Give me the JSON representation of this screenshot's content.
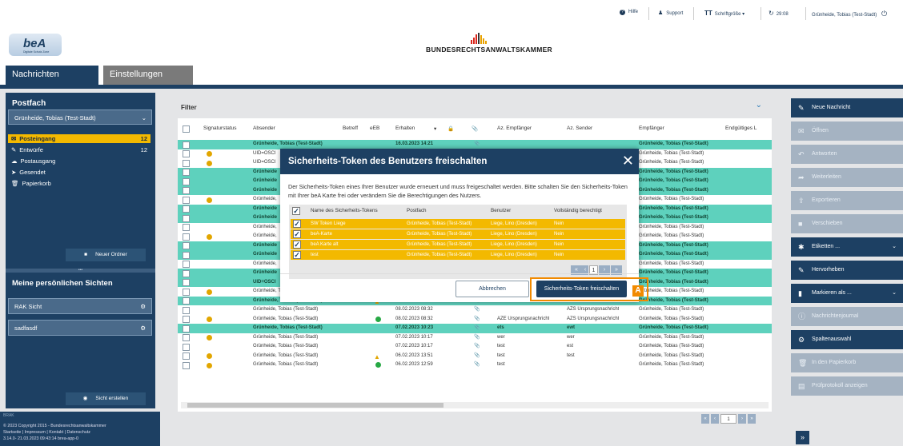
{
  "topbar": {
    "help": "Hilfe",
    "support": "Support",
    "fontsize": "Schriftgröße",
    "timer": "29:08",
    "user": "Grünheide, Tobias (Test-Stadt)"
  },
  "brand": {
    "logo_text": "beA",
    "logo_sub": "Digitale Schutz Zone",
    "org": "BUNDESRECHTSANWALTSKAMMER"
  },
  "nav": {
    "tabs": [
      "Nachrichten",
      "Einstellungen"
    ]
  },
  "sidebar": {
    "postfach_title": "Postfach",
    "postfach_select": "Grünheide, Tobias (Test-Stadt)",
    "folders": [
      {
        "label": "Posteingang",
        "count": "12",
        "icon": "inbox-icon"
      },
      {
        "label": "Entwürfe",
        "count": "12",
        "icon": "edit-icon"
      },
      {
        "label": "Postausgang",
        "count": "",
        "icon": "outbox-icon"
      },
      {
        "label": "Gesendet",
        "count": "",
        "icon": "send-icon"
      },
      {
        "label": "Papierkorb",
        "count": "",
        "icon": "trash-icon"
      }
    ],
    "new_folder": "Neuer Ordner",
    "views_title": "Meine persönlichen Sichten",
    "views": [
      "RAK Sicht",
      "sadfasdf"
    ],
    "create_view": "Sicht erstellen",
    "footer_copyright": "© 2023 Copyright 2015 - Bundesrechtsanwaltskammer",
    "footer_links": "Startseite | Impressum | Kontakt | Datenschutz",
    "footer_version": "3.14.0- 21.03.2023 09:43:14 brea-app-0",
    "footer_logo": "BRAK"
  },
  "filter": {
    "label": "Filter"
  },
  "table": {
    "headers": [
      "Signaturstatus",
      "Absender",
      "Betreff",
      "eEB",
      "Erhalten",
      "Az. Empfänger",
      "Az. Sender",
      "Empfänger",
      "Endgültiges L"
    ],
    "rows": [
      {
        "green": true,
        "dot": false,
        "mark": "",
        "absender": "Grünheide, Tobias (Test-Stadt)",
        "erhalten": "16.03.2023 14:21",
        "clip": true,
        "az_emp": "",
        "az_sen": "",
        "empf": "Grünheide, Tobias (Test-Stadt)"
      },
      {
        "green": false,
        "dot": true,
        "mark": "",
        "absender": "UID=OSCI",
        "erhalten": "",
        "clip": false,
        "az_emp": "",
        "az_sen": "",
        "empf": "Grünheide, Tobias (Test-Stadt)"
      },
      {
        "green": false,
        "dot": true,
        "mark": "",
        "absender": "UID=OSCI",
        "erhalten": "",
        "clip": false,
        "az_emp": "",
        "az_sen": "",
        "empf": "Grünheide, Tobias (Test-Stadt)"
      },
      {
        "green": true,
        "dot": false,
        "mark": "",
        "absender": "Grünheide",
        "erhalten": "",
        "clip": false,
        "az_emp": "",
        "az_sen": "",
        "empf": "Grünheide, Tobias (Test-Stadt)"
      },
      {
        "green": true,
        "dot": false,
        "mark": "",
        "absender": "Grünheide",
        "erhalten": "",
        "clip": false,
        "az_emp": "",
        "az_sen": "",
        "empf": "Grünheide, Tobias (Test-Stadt)"
      },
      {
        "green": true,
        "dot": false,
        "mark": "",
        "absender": "Grünheide",
        "erhalten": "",
        "clip": false,
        "az_emp": "",
        "az_sen": "",
        "empf": "Grünheide, Tobias (Test-Stadt)"
      },
      {
        "green": false,
        "dot": true,
        "mark": "",
        "absender": "Grünheide,",
        "erhalten": "",
        "clip": false,
        "az_emp": "",
        "az_sen": "",
        "empf": "Grünheide, Tobias (Test-Stadt)"
      },
      {
        "green": true,
        "dot": false,
        "mark": "",
        "absender": "Grünheide",
        "erhalten": "",
        "clip": false,
        "az_emp": "",
        "az_sen": "",
        "empf": "Grünheide, Tobias (Test-Stadt)"
      },
      {
        "green": true,
        "dot": false,
        "mark": "",
        "absender": "Grünheide",
        "erhalten": "",
        "clip": false,
        "az_emp": "",
        "az_sen": "",
        "empf": "Grünheide, Tobias (Test-Stadt)"
      },
      {
        "green": false,
        "dot": false,
        "mark": "",
        "absender": "Grünheide,",
        "erhalten": "",
        "clip": false,
        "az_emp": "",
        "az_sen": "",
        "empf": "Grünheide, Tobias (Test-Stadt)"
      },
      {
        "green": false,
        "dot": true,
        "mark": "",
        "absender": "Grünheide,",
        "erhalten": "",
        "clip": false,
        "az_emp": "",
        "az_sen": "",
        "empf": "Grünheide, Tobias (Test-Stadt)"
      },
      {
        "green": true,
        "dot": false,
        "mark": "",
        "absender": "Grünheide",
        "erhalten": "",
        "clip": false,
        "az_emp": "",
        "az_sen": "",
        "empf": "Grünheide, Tobias (Test-Stadt)"
      },
      {
        "green": true,
        "dot": false,
        "mark": "",
        "absender": "Grünheide",
        "erhalten": "",
        "clip": false,
        "az_emp": "",
        "az_sen": "",
        "empf": "Grünheide, Tobias (Test-Stadt)"
      },
      {
        "green": false,
        "dot": false,
        "mark": "",
        "absender": "Grünheide,",
        "erhalten": "",
        "clip": false,
        "az_emp": "",
        "az_sen": "",
        "empf": "Grünheide, Tobias (Test-Stadt)"
      },
      {
        "green": true,
        "dot": false,
        "mark": "",
        "absender": "Grünheide",
        "erhalten": "",
        "clip": false,
        "az_emp": "",
        "az_sen": "",
        "empf": "Grünheide, Tobias (Test-Stadt)"
      },
      {
        "green": true,
        "dot": false,
        "mark": "",
        "absender": "UID=OSCI",
        "erhalten": "",
        "clip": false,
        "az_emp": "",
        "az_sen": "",
        "empf": "Grünheide, Tobias (Test-Stadt)"
      },
      {
        "green": false,
        "dot": true,
        "mark": "warn",
        "absender": "Grünheide, Tobias (Test-Stadt)",
        "erhalten": "14.02.2023 09:21",
        "clip": true,
        "az_emp": "test",
        "az_sen": "test",
        "empf": "Grünheide, Tobias (Test-Stadt)"
      },
      {
        "green": true,
        "dot": false,
        "mark": "warn",
        "absender": "Grünheide, Tobias (Test-Stadt)",
        "erhalten": "14.02.2023 09:19",
        "clip": true,
        "az_emp": "test",
        "az_sen": "test",
        "empf": "Grünheide, Tobias (Test-Stadt)"
      },
      {
        "green": false,
        "dot": false,
        "mark": "",
        "absender": "Grünheide, Tobias (Test-Stadt)",
        "erhalten": "08.02.2023 08:32",
        "clip": true,
        "az_emp": "",
        "az_sen": "AZS Ursprungsnachricht",
        "empf": "Grünheide, Tobias (Test-Stadt)"
      },
      {
        "green": false,
        "dot": true,
        "mark": "ok",
        "absender": "Grünheide, Tobias (Test-Stadt)",
        "erhalten": "08.02.2023 08:32",
        "clip": true,
        "az_emp": "AZE Ursprungsnachricht",
        "az_sen": "AZS Ursprungsnachricht",
        "empf": "Grünheide, Tobias (Test-Stadt)"
      },
      {
        "green": true,
        "dot": false,
        "mark": "",
        "absender": "Grünheide, Tobias (Test-Stadt)",
        "erhalten": "07.02.2023 10:23",
        "clip": true,
        "az_emp": "ets",
        "az_sen": "ewt",
        "empf": "Grünheide, Tobias (Test-Stadt)"
      },
      {
        "green": false,
        "dot": true,
        "mark": "",
        "absender": "Grünheide, Tobias (Test-Stadt)",
        "erhalten": "07.02.2023 10:17",
        "clip": true,
        "az_emp": "wer",
        "az_sen": "wer",
        "empf": "Grünheide, Tobias (Test-Stadt)"
      },
      {
        "green": false,
        "dot": false,
        "mark": "",
        "absender": "Grünheide, Tobias (Test-Stadt)",
        "erhalten": "07.02.2023 10:17",
        "clip": true,
        "az_emp": "test",
        "az_sen": "est",
        "empf": "Grünheide, Tobias (Test-Stadt)"
      },
      {
        "green": false,
        "dot": true,
        "mark": "warn",
        "absender": "Grünheide, Tobias (Test-Stadt)",
        "erhalten": "06.02.2023 13:51",
        "clip": true,
        "az_emp": "test",
        "az_sen": "test",
        "empf": "Grünheide, Tobias (Test-Stadt)"
      },
      {
        "green": false,
        "dot": true,
        "mark": "ok",
        "absender": "Grünheide, Tobias (Test-Stadt)",
        "erhalten": "06.02.2023 12:59",
        "clip": true,
        "az_emp": "test",
        "az_sen": "",
        "empf": "Grünheide, Tobias (Test-Stadt)"
      }
    ],
    "pager_current": "1"
  },
  "right_panel": {
    "buttons": [
      {
        "label": "Neue Nachricht",
        "on": true,
        "icon": "pencil-icon",
        "chev": false
      },
      {
        "label": "Öffnen",
        "on": false,
        "icon": "mail-icon",
        "chev": false
      },
      {
        "label": "Antworten",
        "on": false,
        "icon": "reply-icon",
        "chev": false
      },
      {
        "label": "Weiterleiten",
        "on": false,
        "icon": "forward-icon",
        "chev": false
      },
      {
        "label": "Exportieren",
        "on": false,
        "icon": "export-icon",
        "chev": false
      },
      {
        "label": "Verschieben",
        "on": false,
        "icon": "folder-icon",
        "chev": false
      },
      {
        "label": "Etiketten ...",
        "on": true,
        "icon": "tag-icon",
        "chev": true
      },
      {
        "label": "Hervorheben",
        "on": true,
        "icon": "marker-icon",
        "chev": false
      },
      {
        "label": "Markieren als ...",
        "on": true,
        "icon": "bookmark-icon",
        "chev": true
      },
      {
        "label": "Nachrichtenjournal",
        "on": false,
        "icon": "info-icon",
        "chev": false
      },
      {
        "label": "Spaltenauswahl",
        "on": true,
        "icon": "gear-icon",
        "chev": false
      },
      {
        "label": "In den Papierkorb",
        "on": false,
        "icon": "trash-icon",
        "chev": false
      },
      {
        "label": "Prüfprotokoll anzeigen",
        "on": false,
        "icon": "document-icon",
        "chev": false
      }
    ],
    "collapse": "»"
  },
  "modal": {
    "title": "Sicherheits-Token des Benutzers freischalten",
    "description": "Der Sicherheits-Token eines Ihrer Benutzer wurde erneuert und muss freigeschaltet werden. Bitte schalten Sie den Sicherheits-Token mit Ihrer beA Karte frei oder verändern Sie die Berechtigungen des Nutzers.",
    "headers": [
      "Name des Sicherheits-Tokens",
      "Postfach",
      "Benutzer",
      "Vollständig berechtigt"
    ],
    "rows": [
      {
        "name": "SW Token Liege",
        "postfach": "Grünheide, Tobias (Test-Stadt)",
        "benutzer": "Liege, Lino (Dresden)",
        "berechtigt": "Nein"
      },
      {
        "name": "beA-Karte",
        "postfach": "Grünheide, Tobias (Test-Stadt)",
        "benutzer": "Liege, Lino (Dresden)",
        "berechtigt": "Nein"
      },
      {
        "name": "beA Karte alt",
        "postfach": "Grünheide, Tobias (Test-Stadt)",
        "benutzer": "Liege, Lino (Dresden)",
        "berechtigt": "Nein"
      },
      {
        "name": "test",
        "postfach": "Grünheide, Tobias (Test-Stadt)",
        "benutzer": "Liege, Lino (Dresden)",
        "berechtigt": "Nein"
      }
    ],
    "pager_current": "1",
    "cancel": "Abbrechen",
    "confirm": "Sicherheits-Token freischalten"
  },
  "annotation": {
    "badge": "A"
  },
  "colors": {
    "navy": "#1d4063",
    "green_row": "#5ed1bd",
    "amber": "#f3b900",
    "annotation": "#f18a00"
  }
}
